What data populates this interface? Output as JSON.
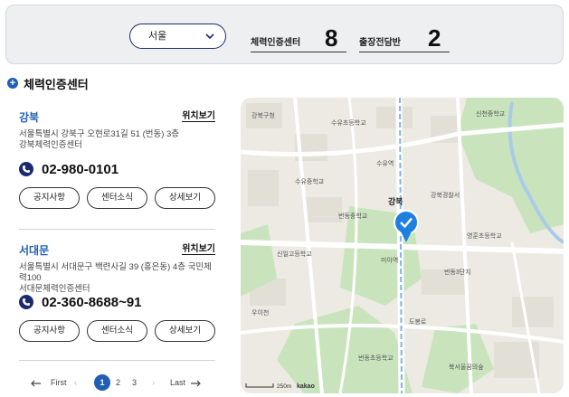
{
  "filter": {
    "region": "서울",
    "stats": [
      {
        "label": "체력인증센터",
        "value": "8"
      },
      {
        "label": "출장전담반",
        "value": "2"
      }
    ]
  },
  "section_title": "체력인증센터",
  "centers": [
    {
      "name": "강북",
      "location_link": "위치보기",
      "address_line1": "서울특별시 강북구 오현로31길 51 (번동) 3층",
      "address_line2": "강북체력인증센터",
      "phone": "02-980-0101",
      "buttons": [
        "공지사항",
        "센터소식",
        "상세보기"
      ]
    },
    {
      "name": "서대문",
      "location_link": "위치보기",
      "address_line1": "서울특별시 서대문구 백련사길 39 (홍은동) 4층 국민체력100",
      "address_line2": "서대문체력인증센터",
      "phone": "02-360-8688~91",
      "buttons": [
        "공지사항",
        "센터소식",
        "상세보기"
      ]
    }
  ],
  "pagination": {
    "first": "First",
    "pages": [
      "1",
      "2",
      "3"
    ],
    "current": "1",
    "last": "Last"
  },
  "map": {
    "marker_label": "강북",
    "scale_label": "250m",
    "provider": "kakao",
    "labels": [
      "강북구청",
      "수유초등학교",
      "수유역",
      "수유중학교",
      "번동중학교",
      "강북경찰서",
      "미아역",
      "신일고등학교",
      "번동3단지",
      "도봉로",
      "신천중학교",
      "영훈초등학교",
      "우이천",
      "번동초등학교",
      "북서울꿈의숲"
    ],
    "colors": {
      "marker": "#1f7fe0",
      "park": "#c9e4bd",
      "road": "#ffffff",
      "rail": "#7fb3ea"
    }
  },
  "icons": [
    "plus-icon",
    "chevron-down-icon",
    "phone-icon",
    "check-marker-icon",
    "arrow-left-icon",
    "arrow-right-icon"
  ]
}
